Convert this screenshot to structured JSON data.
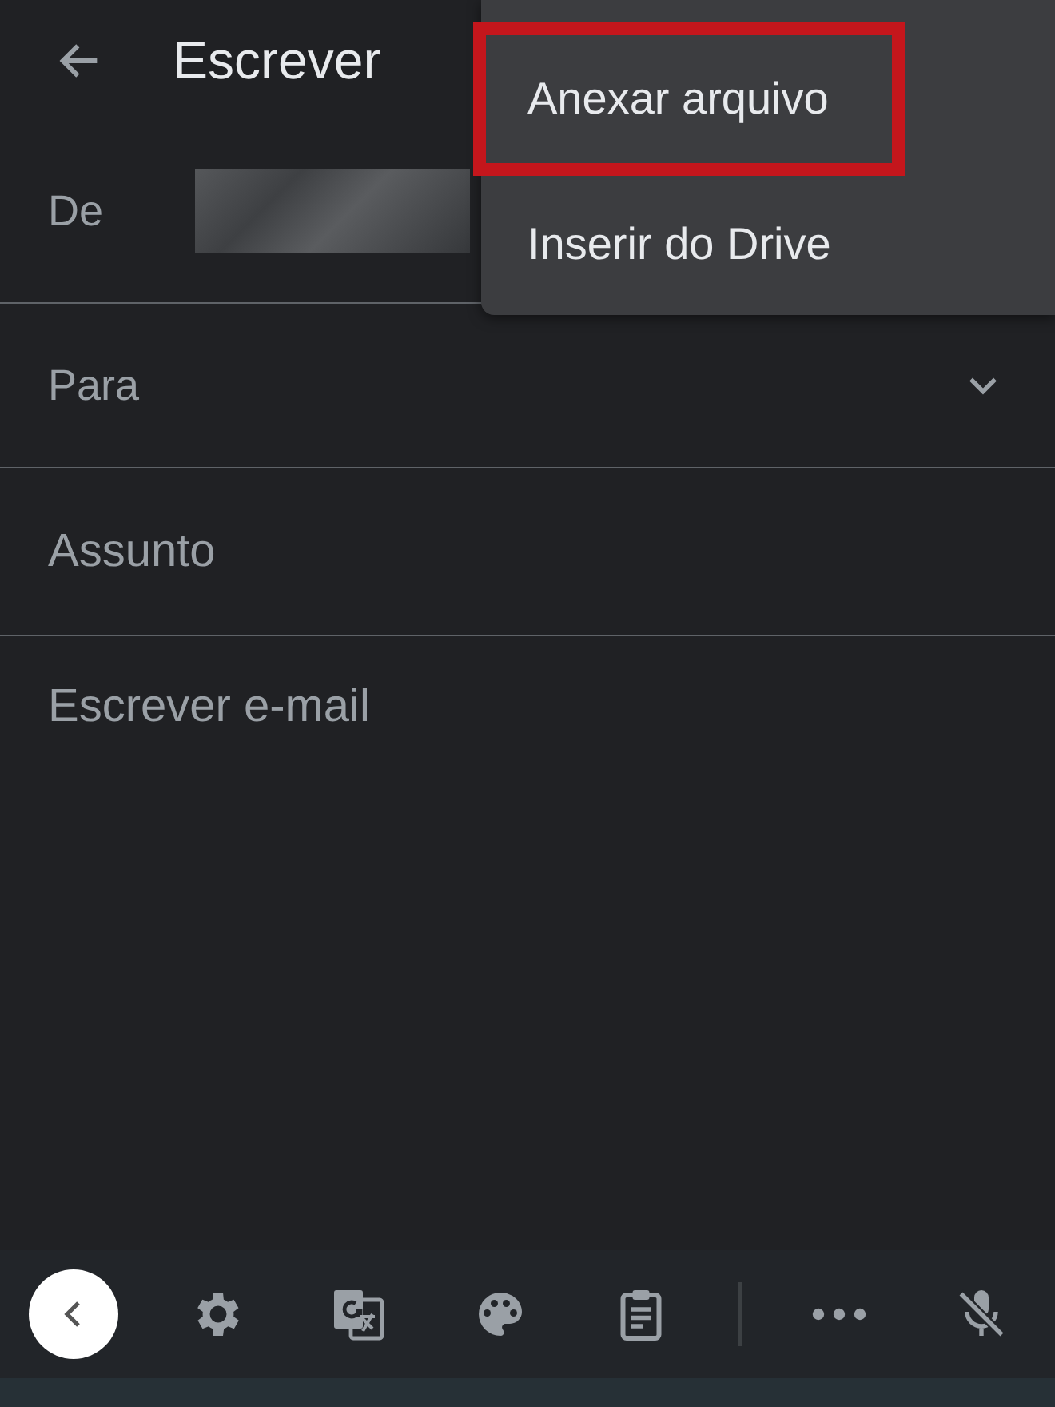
{
  "header": {
    "title": "Escrever"
  },
  "from": {
    "label": "De"
  },
  "to": {
    "label": "Para"
  },
  "subject": {
    "placeholder": "Assunto"
  },
  "body": {
    "placeholder": "Escrever e-mail"
  },
  "menu": {
    "items": [
      {
        "label": "Anexar arquivo",
        "highlighted": true
      },
      {
        "label": "Inserir do Drive",
        "highlighted": false
      }
    ]
  },
  "keyboard_toolbar": {
    "items": [
      {
        "kind": "collapse"
      },
      {
        "kind": "settings"
      },
      {
        "kind": "translate"
      },
      {
        "kind": "palette"
      },
      {
        "kind": "clipboard"
      },
      {
        "kind": "divider"
      },
      {
        "kind": "more"
      },
      {
        "kind": "mic_off"
      }
    ]
  }
}
